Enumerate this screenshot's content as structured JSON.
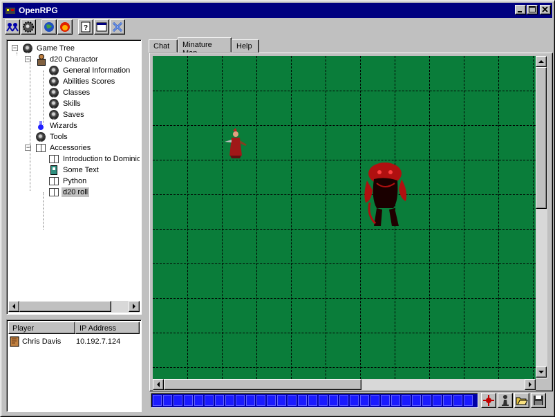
{
  "window": {
    "title": "OpenRPG"
  },
  "toolbar": {
    "buttons": [
      "players-icon",
      "gear-icon",
      "globe-icon",
      "fireball-icon",
      "help-icon",
      "window-icon",
      "close-x-icon"
    ]
  },
  "tree": {
    "items": [
      {
        "label": "Game Tree",
        "icon": "gear-icon",
        "level": 0,
        "expander": "−"
      },
      {
        "label": "d20 Charactor",
        "icon": "character-icon",
        "level": 1,
        "expander": "−"
      },
      {
        "label": "General Information",
        "icon": "gear-icon",
        "level": 2
      },
      {
        "label": "Abilities Scores",
        "icon": "gear-icon",
        "level": 2
      },
      {
        "label": "Classes",
        "icon": "gear-icon",
        "level": 2
      },
      {
        "label": "Skills",
        "icon": "gear-icon",
        "level": 2
      },
      {
        "label": "Saves",
        "icon": "gear-icon",
        "level": 2
      },
      {
        "label": "Wizards",
        "icon": "flask-icon",
        "level": 1
      },
      {
        "label": "Tools",
        "icon": "gear-icon",
        "level": 1
      },
      {
        "label": "Accessories",
        "icon": "book-icon",
        "level": 1,
        "expander": "−"
      },
      {
        "label": "Introduction to Dominion",
        "icon": "book-icon",
        "level": 2
      },
      {
        "label": "Some Text",
        "icon": "page-icon",
        "level": 2
      },
      {
        "label": "Python",
        "icon": "book-icon",
        "level": 2
      },
      {
        "label": "d20 roll",
        "icon": "book-icon",
        "level": 2,
        "selected": true
      }
    ]
  },
  "players": {
    "columns": [
      "Player",
      "IP Address"
    ],
    "rows": [
      {
        "name": "Chris Davis",
        "ip": "10.192.7.124"
      }
    ]
  },
  "tabs": [
    {
      "label": "Chat",
      "active": false
    },
    {
      "label": "Minature Map",
      "active": true
    },
    {
      "label": "Help",
      "active": false
    }
  ],
  "map": {
    "background": "#0a7d3a",
    "tokens": [
      "wizard-miniature",
      "demon-miniature"
    ]
  },
  "bottom_toolbar": {
    "buttons": [
      "target-icon",
      "pawn-icon",
      "open-folder-icon",
      "save-icon"
    ]
  },
  "colors": {
    "titlebar": "#000080",
    "status_bar": "#0000a8",
    "map": "#0a7d3a"
  }
}
